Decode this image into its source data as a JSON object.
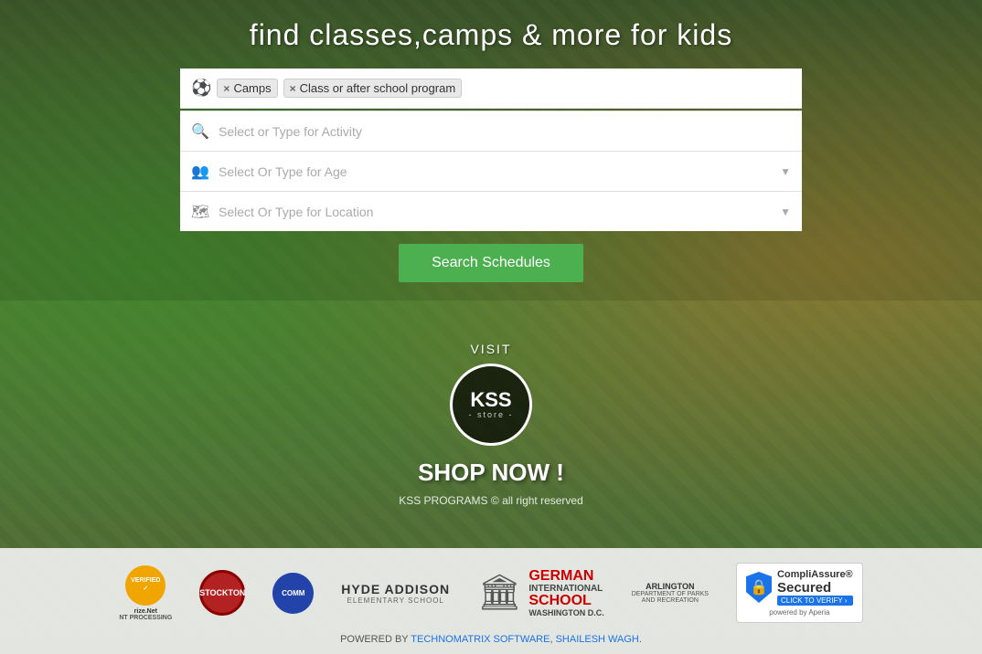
{
  "page": {
    "title": "find classes,camps & more for kids"
  },
  "tags": [
    {
      "label": "Camps",
      "id": "camps"
    },
    {
      "label": "Class or after school program",
      "id": "class-after-school"
    }
  ],
  "search": {
    "activity_placeholder": "Select or Type for Activity",
    "age_placeholder": "Select Or Type for Age",
    "location_placeholder": "Select Or Type for Location",
    "button_label": "Search Schedules"
  },
  "kss_store": {
    "visit_label": "VISIT",
    "logo_main": "KSS",
    "logo_sub": "- store -",
    "shop_label": "SHOP NOW !",
    "copyright": "KSS PROGRAMS © all right reserved"
  },
  "partners": [
    {
      "name": "AuthorizeNet",
      "label": "AUTHORIZE.NET",
      "sub": "PAYMENT PROCESSING"
    },
    {
      "name": "Stockton",
      "label": "STOCKTON"
    },
    {
      "name": "Community",
      "label": "COMMUNITY"
    },
    {
      "name": "HydeAddison",
      "label": "HYDE ADDISON",
      "sub": "ELEMENTARY SCHOOL"
    },
    {
      "name": "GermanInternationalSchool",
      "label": "GERMAN\nINTERNATIONAL\nSCHOOL\nWASHINGTON D.C."
    },
    {
      "name": "Arlington",
      "label": "ARLINGTON",
      "sub": "DEPARTMENT OF PARKS\nAND RECREATION"
    },
    {
      "name": "CompliAssure",
      "label": "CompliAssure®",
      "sub": "Secured",
      "verify": "CLICK TO VERIFY >",
      "powered": "powered by Aperia"
    }
  ],
  "footer": {
    "powered_by": "POWERED BY",
    "link1": "TECHNOMATRIX SOFTWARE",
    "comma": ", ",
    "link2": "SHAILESH WAGH",
    "period": "."
  }
}
